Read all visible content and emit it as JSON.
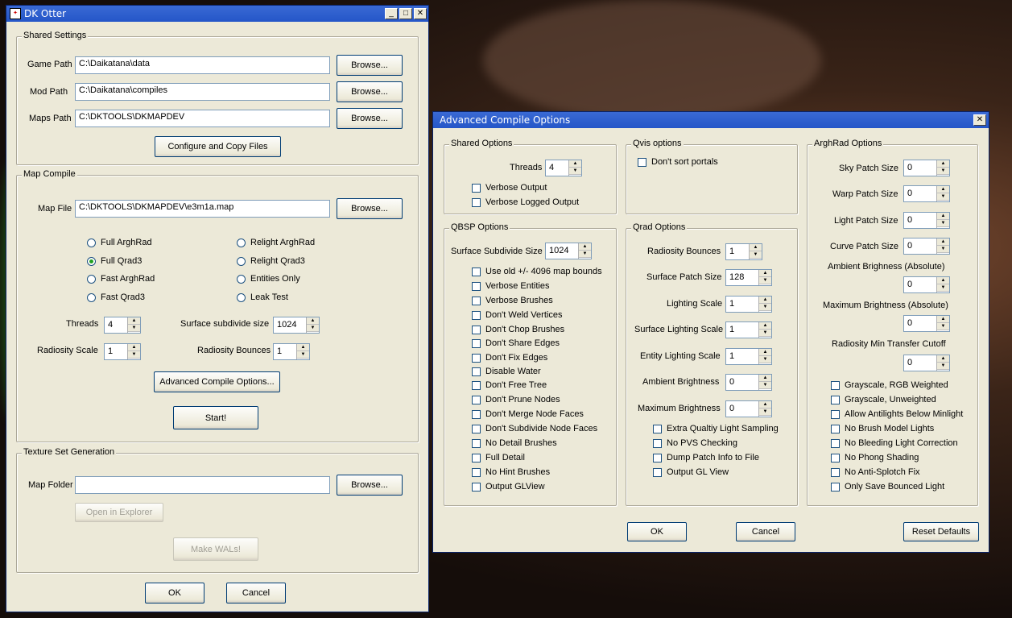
{
  "dk": {
    "title": "DK Otter",
    "shared": {
      "legend": "Shared Settings",
      "game_path_label": "Game Path",
      "game_path": "C:\\Daikatana\\data",
      "mod_path_label": "Mod Path",
      "mod_path": "C:\\Daikatana\\compiles",
      "maps_path_label": "Maps Path",
      "maps_path": "C:\\DKTOOLS\\DKMAPDEV",
      "browse": "Browse...",
      "configure": "Configure and Copy Files"
    },
    "compile": {
      "legend": "Map Compile",
      "map_file_label": "Map File",
      "map_file": "C:\\DKTOOLS\\DKMAPDEV\\e3m1a.map",
      "browse": "Browse...",
      "radios": [
        "Full ArghRad",
        "Relight ArghRad",
        "Full Qrad3",
        "Relight Qrad3",
        "Fast ArghRad",
        "Entities Only",
        "Fast Qrad3",
        "Leak Test"
      ],
      "selected": "Full Qrad3",
      "threads_label": "Threads",
      "threads": "4",
      "subdiv_label": "Surface subdivide size",
      "subdiv": "1024",
      "rad_scale_label": "Radiosity Scale",
      "rad_scale": "1",
      "rad_bounces_label": "Radiosity Bounces",
      "rad_bounces": "1",
      "advanced": "Advanced Compile Options...",
      "start": "Start!"
    },
    "texture": {
      "legend": "Texture Set Generation",
      "folder_label": "Map Folder",
      "folder": "",
      "browse": "Browse...",
      "open": "Open in Explorer",
      "make": "Make WALs!"
    },
    "ok": "OK",
    "cancel": "Cancel"
  },
  "adv": {
    "title": "Advanced Compile Options",
    "shared": {
      "legend": "Shared Options",
      "threads_label": "Threads",
      "threads": "4",
      "checks": [
        "Verbose Output",
        "Verbose Logged Output"
      ]
    },
    "qvis": {
      "legend": "Qvis options",
      "checks": [
        "Don't sort portals"
      ]
    },
    "qbsp": {
      "legend": "QBSP Options",
      "subdiv_label": "Surface Subdivide Size",
      "subdiv": "1024",
      "checks": [
        "Use old +/- 4096 map bounds",
        "Verbose Entities",
        "Verbose Brushes",
        "Don't Weld Vertices",
        "Don't Chop Brushes",
        "Don't Share Edges",
        "Don't Fix Edges",
        "Disable Water",
        "Don't Free Tree",
        "Don't Prune Nodes",
        "Don't Merge Node Faces",
        "Don't Subdivide Node Faces",
        "No Detail Brushes",
        "Full Detail",
        "No Hint Brushes",
        "Output GLView"
      ]
    },
    "qrad": {
      "legend": "Qrad Options",
      "fields": [
        {
          "label": "Radiosity Bounces",
          "value": "1"
        },
        {
          "label": "Surface Patch Size",
          "value": "128"
        },
        {
          "label": "Lighting Scale",
          "value": "1"
        },
        {
          "label": "Surface Lighting Scale",
          "value": "1"
        },
        {
          "label": "Entity Lighting Scale",
          "value": "1"
        },
        {
          "label": "Ambient Brightness",
          "value": "0"
        },
        {
          "label": "Maximum Brightness",
          "value": "0"
        }
      ],
      "checks": [
        "Extra Qualtiy Light Sampling",
        "No PVS Checking",
        "Dump Patch Info to File",
        "Output GL View"
      ]
    },
    "argh": {
      "legend": "ArghRad Options",
      "fields": [
        {
          "label": "Sky Patch Size",
          "value": "0"
        },
        {
          "label": "Warp Patch Size",
          "value": "0"
        },
        {
          "label": "Light Patch Size",
          "value": "0"
        },
        {
          "label": "Curve Patch Size",
          "value": "0"
        }
      ],
      "ambient_label": "Ambient Brighness (Absolute)",
      "ambient": "0",
      "max_label": "Maximum Brightness (Absolute)",
      "max": "0",
      "cutoff_label": "Radiosity Min Transfer Cutoff",
      "cutoff": "0",
      "checks": [
        "Grayscale, RGB Weighted",
        "Grayscale, Unweighted",
        "Allow Antilights Below Minlight",
        "No Brush Model Lights",
        "No Bleeding Light Correction",
        "No Phong Shading",
        "No Anti-Splotch Fix",
        "Only Save Bounced Light"
      ]
    },
    "ok": "OK",
    "cancel": "Cancel",
    "reset": "Reset Defaults"
  }
}
